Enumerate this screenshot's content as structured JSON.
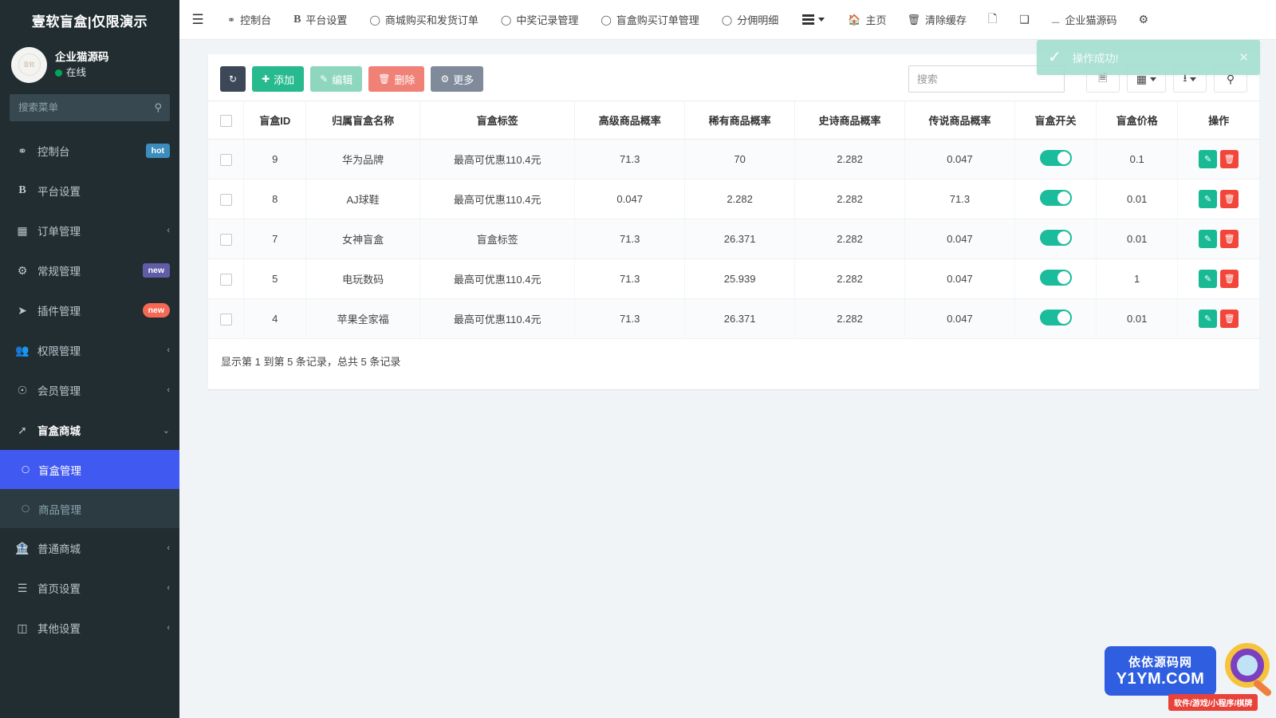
{
  "sidebar": {
    "brand": "壹软盲盒|仅限演示",
    "user": {
      "name": "企业猫源码",
      "status": "在线"
    },
    "search_placeholder": "搜索菜单",
    "items": [
      {
        "label": "控制台",
        "icon": "dashboard-icon",
        "badge": "hot",
        "badge_type": "hot",
        "caret": ""
      },
      {
        "label": "平台设置",
        "icon": "b-icon",
        "badge": "",
        "badge_type": "",
        "caret": ""
      },
      {
        "label": "订单管理",
        "icon": "grid-icon",
        "badge": "",
        "badge_type": "",
        "caret": "‹"
      },
      {
        "label": "常规管理",
        "icon": "gears-icon",
        "badge": "new",
        "badge_type": "new-purple",
        "caret": ""
      },
      {
        "label": "插件管理",
        "icon": "rocket-icon",
        "badge": "new",
        "badge_type": "new-red",
        "caret": ""
      },
      {
        "label": "权限管理",
        "icon": "users-icon",
        "badge": "",
        "badge_type": "",
        "caret": "‹"
      },
      {
        "label": "会员管理",
        "icon": "user-circle-icon",
        "badge": "",
        "badge_type": "",
        "caret": "‹"
      },
      {
        "label": "盲盒商城",
        "icon": "shuttle-icon",
        "badge": "",
        "badge_type": "",
        "caret": "⌄"
      }
    ],
    "submenu": [
      {
        "label": "盲盒管理",
        "active": true
      },
      {
        "label": "商品管理",
        "active": false
      }
    ],
    "items_bottom": [
      {
        "label": "普通商城",
        "icon": "bank-icon",
        "badge": "",
        "badge_type": "",
        "caret": "‹"
      },
      {
        "label": "首页设置",
        "icon": "list-icon",
        "badge": "",
        "badge_type": "",
        "caret": "‹"
      },
      {
        "label": "其他设置",
        "icon": "database-icon",
        "badge": "",
        "badge_type": "",
        "caret": "‹"
      }
    ]
  },
  "topbar": {
    "menu_toggle": "☰",
    "nav": [
      {
        "label": "控制台",
        "icon": "dashboard-icon"
      },
      {
        "label": "平台设置",
        "icon": "b-icon"
      },
      {
        "label": "商城购买和发货订单",
        "icon": "circle-icon"
      },
      {
        "label": "中奖记录管理",
        "icon": "circle-icon"
      },
      {
        "label": "盲盒购买订单管理",
        "icon": "circle-icon"
      },
      {
        "label": "分佣明细",
        "icon": "circle-icon"
      }
    ],
    "right": [
      {
        "label": "主页",
        "icon": "home-icon"
      },
      {
        "label": "清除缓存",
        "icon": "trash-icon"
      }
    ],
    "user_label": "企业猫源码"
  },
  "toolbar": {
    "refresh_label": "",
    "add_label": "添加",
    "edit_label": "编辑",
    "delete_label": "删除",
    "more_label": "更多",
    "search_placeholder": "搜索"
  },
  "toast": {
    "message": "操作成功!",
    "close": "✕"
  },
  "table": {
    "columns": [
      "",
      "盲盒ID",
      "归属盲盒名称",
      "盲盒标签",
      "高级商品概率",
      "稀有商品概率",
      "史诗商品概率",
      "传说商品概率",
      "盲盒开关",
      "盲盒价格",
      "操作"
    ],
    "rows": [
      {
        "id": "9",
        "name": "华为品牌",
        "tag": "最高可优惠110.4元",
        "p_advanced": "71.3",
        "p_rare": "70",
        "p_epic": "2.282",
        "p_legend": "0.047",
        "switch": true,
        "price": "0.1"
      },
      {
        "id": "8",
        "name": "AJ球鞋",
        "tag": "最高可优惠110.4元",
        "p_advanced": "0.047",
        "p_rare": "2.282",
        "p_epic": "2.282",
        "p_legend": "71.3",
        "switch": true,
        "price": "0.01"
      },
      {
        "id": "7",
        "name": "女神盲盒",
        "tag": "盲盒标签",
        "p_advanced": "71.3",
        "p_rare": "26.371",
        "p_epic": "2.282",
        "p_legend": "0.047",
        "switch": true,
        "price": "0.01"
      },
      {
        "id": "5",
        "name": "电玩数码",
        "tag": "最高可优惠110.4元",
        "p_advanced": "71.3",
        "p_rare": "25.939",
        "p_epic": "2.282",
        "p_legend": "0.047",
        "switch": true,
        "price": "1"
      },
      {
        "id": "4",
        "name": "苹果全家福",
        "tag": "最高可优惠110.4元",
        "p_advanced": "71.3",
        "p_rare": "26.371",
        "p_epic": "2.282",
        "p_legend": "0.047",
        "switch": true,
        "price": "0.01"
      }
    ],
    "footer": "显示第 1 到第 5 条记录，总共 5 条记录"
  },
  "watermark": {
    "line1": "依依源码网",
    "line2": "Y1YM.COM",
    "line3": "软件/游戏/小程序/棋牌"
  },
  "colors": {
    "accent_green": "#27ba8e",
    "active_blue": "#4059f0",
    "sidebar_bg": "#222d32",
    "danger": "#f2463a",
    "toggle_on": "#1abc9c"
  }
}
